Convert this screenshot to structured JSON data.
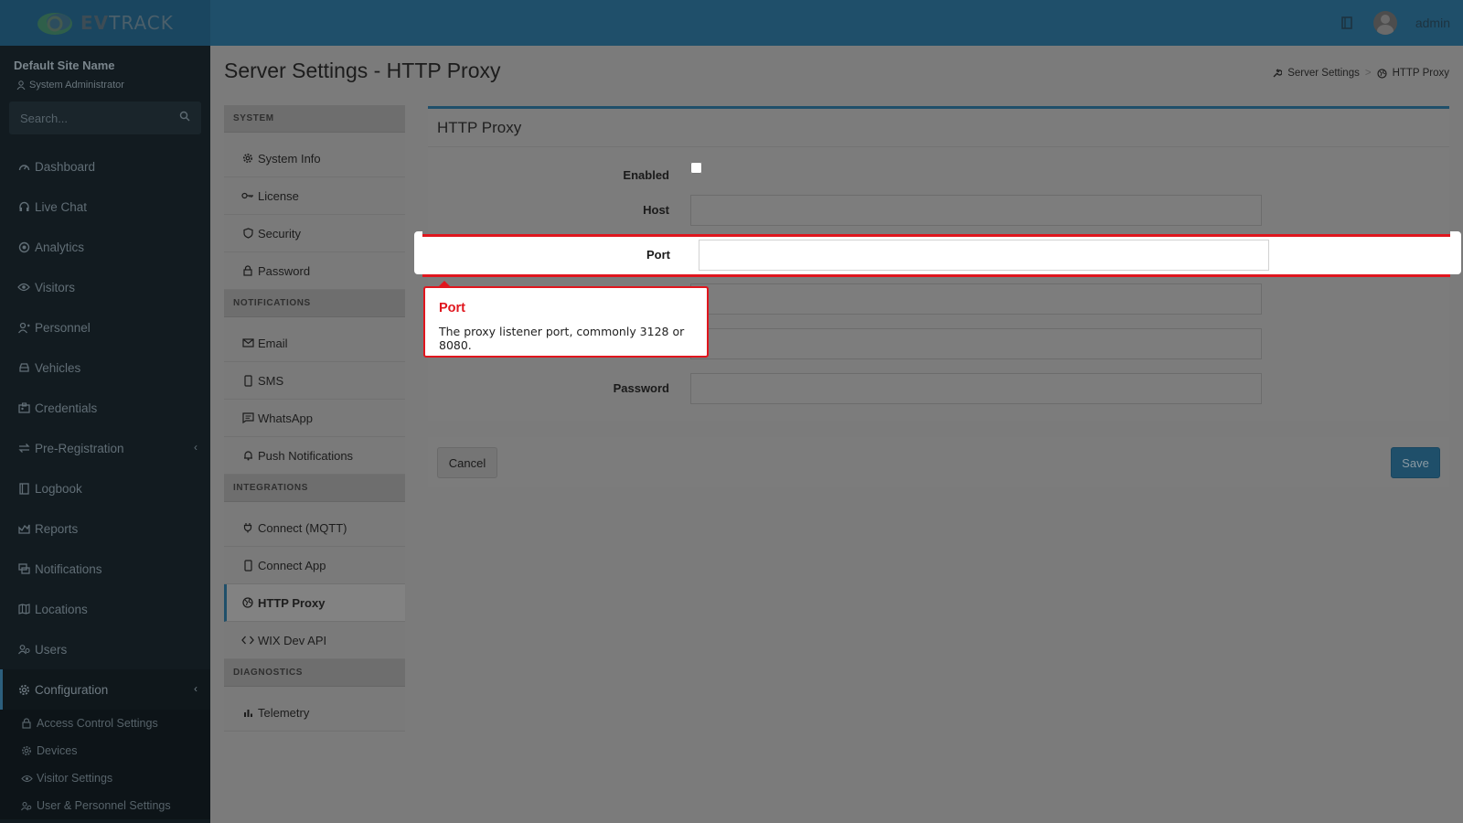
{
  "app": {
    "brand_name": "EVTRACK",
    "brand_bold": "EV",
    "brand_light": "TRACK"
  },
  "topbar": {
    "user_name": "admin",
    "icons": [
      "book-icon",
      "avatar"
    ]
  },
  "sidebar": {
    "site_name": "Default Site Name",
    "site_role": "System Administrator",
    "search_placeholder": "Search...",
    "items": [
      {
        "label": "Dashboard",
        "icon": "dashboard-icon"
      },
      {
        "label": "Live Chat",
        "icon": "headset-icon"
      },
      {
        "label": "Analytics",
        "icon": "analytics-icon"
      },
      {
        "label": "Visitors",
        "icon": "eye-icon"
      },
      {
        "label": "Personnel",
        "icon": "person-icon"
      },
      {
        "label": "Vehicles",
        "icon": "car-icon"
      },
      {
        "label": "Credentials",
        "icon": "id-card-icon"
      },
      {
        "label": "Pre-Registration",
        "icon": "swap-icon"
      },
      {
        "label": "Logbook",
        "icon": "book-icon"
      },
      {
        "label": "Reports",
        "icon": "chart-icon"
      },
      {
        "label": "Notifications",
        "icon": "chat-icon"
      },
      {
        "label": "Locations",
        "icon": "map-icon"
      },
      {
        "label": "Users",
        "icon": "users-icon"
      },
      {
        "label": "Configuration",
        "icon": "gear-icon"
      }
    ],
    "sub_items": [
      {
        "label": "Access Control Settings",
        "icon": "lock-icon"
      },
      {
        "label": "Devices",
        "icon": "cog-icon"
      },
      {
        "label": "Visitor Settings",
        "icon": "eye-icon"
      },
      {
        "label": "User & Personnel Settings",
        "icon": "users-icon"
      }
    ]
  },
  "page": {
    "title": "Server Settings - HTTP Proxy",
    "breadcrumb": [
      "Server Settings",
      "HTTP Proxy"
    ],
    "breadcrumb_sep": ">"
  },
  "settings_menu": {
    "sections": [
      {
        "header": "SYSTEM",
        "items": [
          "System Info",
          "License",
          "Security",
          "Password"
        ]
      },
      {
        "header": "NOTIFICATIONS",
        "items": [
          "Email",
          "SMS",
          "WhatsApp",
          "Push Notifications"
        ]
      },
      {
        "header": "INTEGRATIONS",
        "items": [
          "Connect (MQTT)",
          "Connect App",
          "HTTP Proxy",
          "WIX Dev API"
        ]
      },
      {
        "header": "DIAGNOSTICS",
        "items": [
          "Telemetry"
        ]
      }
    ]
  },
  "form": {
    "title": "HTTP Proxy",
    "enabled_label": "Enabled",
    "host_label": "Host",
    "port_label": "Port",
    "password_label": "Password"
  },
  "tooltip": {
    "title": "Port",
    "body": "The proxy listener port, commonly 3128 or 8080."
  },
  "actions": {
    "cancel_label": "Cancel",
    "save_label": "Save"
  },
  "colors": {
    "primary": "#1f4f6a",
    "highlight_border": "#e0161e"
  }
}
